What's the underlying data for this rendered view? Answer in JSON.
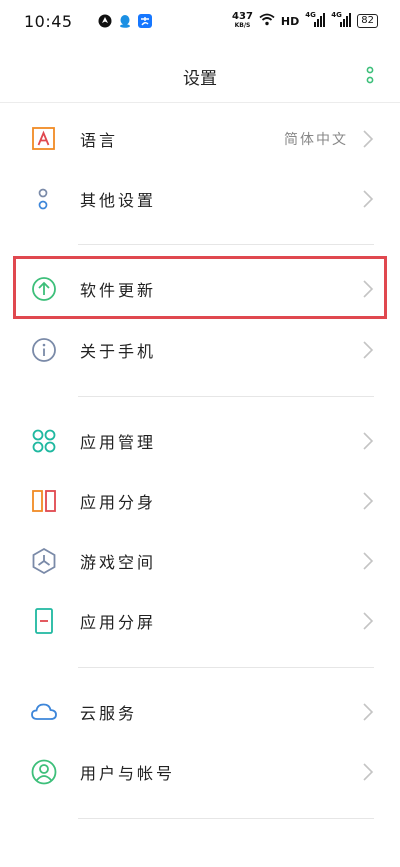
{
  "status_bar": {
    "time": "10:45",
    "speed_value": "437",
    "speed_unit": "KB/S",
    "hd_label": "HD",
    "signal_label_1": "4G",
    "signal_label_2": "4G",
    "battery": "82"
  },
  "header": {
    "title": "设置",
    "more_icon": "more-dots-icon"
  },
  "items": [
    {
      "label": "语言",
      "value": "简体中文",
      "icon": "language-icon"
    },
    {
      "label": "其他设置",
      "icon": "other-settings-icon"
    },
    {
      "label": "软件更新",
      "icon": "software-update-icon",
      "highlighted": true
    },
    {
      "label": "关于手机",
      "icon": "about-phone-icon"
    },
    {
      "label": "应用管理",
      "icon": "app-management-icon"
    },
    {
      "label": "应用分身",
      "icon": "app-clone-icon"
    },
    {
      "label": "游戏空间",
      "icon": "game-space-icon"
    },
    {
      "label": "应用分屏",
      "icon": "split-screen-icon"
    },
    {
      "label": "云服务",
      "icon": "cloud-service-icon"
    },
    {
      "label": "用户与帐号",
      "icon": "user-account-icon"
    }
  ],
  "colors": {
    "highlight_border": "#e0484f",
    "accent_green": "#3dbf7a",
    "accent_orange": "#f08a24",
    "accent_teal": "#1fb8a0",
    "accent_blue": "#3d86d9",
    "icon_gray": "#7a8aa8"
  }
}
